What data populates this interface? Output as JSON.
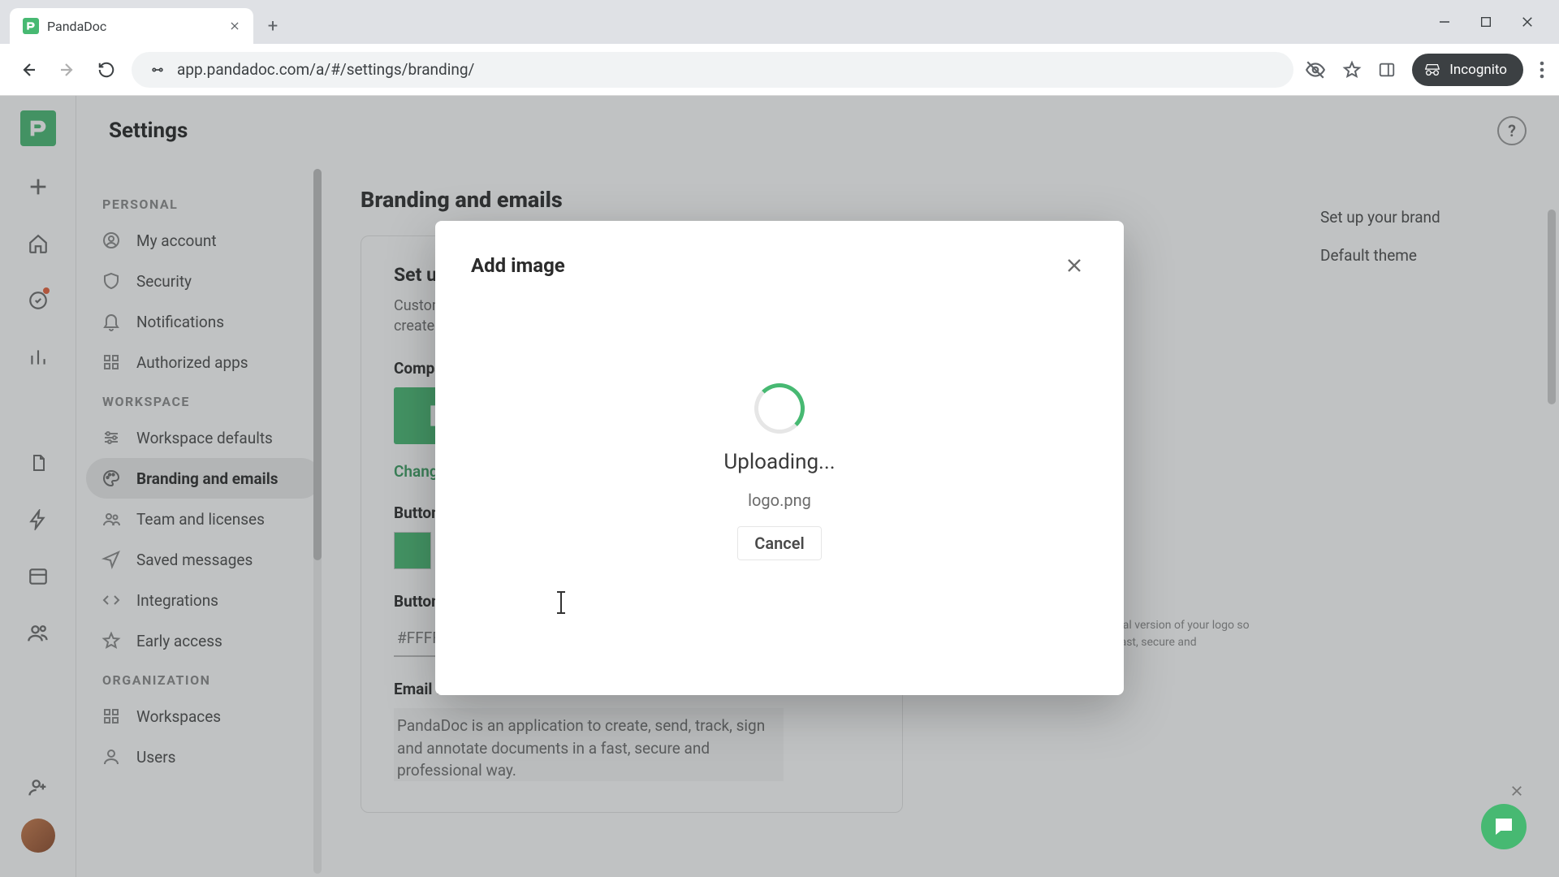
{
  "browser": {
    "tab_title": "PandaDoc",
    "url": "app.pandadoc.com/a/#/settings/branding/",
    "incognito_label": "Incognito"
  },
  "page": {
    "header_title": "Settings",
    "content_title": "Branding and emails"
  },
  "sidebar": {
    "sections": {
      "personal": "PERSONAL",
      "workspace": "WORKSPACE",
      "organization": "ORGANIZATION"
    },
    "items": {
      "my_account": "My account",
      "security": "Security",
      "notifications": "Notifications",
      "authorized_apps": "Authorized apps",
      "workspace_defaults": "Workspace defaults",
      "branding_emails": "Branding and emails",
      "team_licenses": "Team and licenses",
      "saved_messages": "Saved messages",
      "integrations": "Integrations",
      "early_access": "Early access",
      "workspaces": "Workspaces",
      "users": "Users"
    }
  },
  "branding": {
    "card_title": "Set up your brand",
    "card_desc": "Customize your branding — it will show up on documents you create and emails you send.",
    "company_logo_label": "Company logo",
    "change_link": "Change",
    "button_color_label": "Button color",
    "button_text_color_label": "Button text color",
    "button_text_color_value": "#FFFFFF",
    "email_footer_label": "Email footer text",
    "email_footer_value": "PandaDoc is an application to create, send, track, sign and annotate documents in a fast, secure and professional way.",
    "preview_note": "For best results, upload a horizontal version of your logo so it looks great on documents in a fast, secure and professional way."
  },
  "toc": {
    "brand": "Set up your brand",
    "theme": "Default theme"
  },
  "modal": {
    "title": "Add image",
    "status": "Uploading...",
    "filename": "logo.png",
    "cancel": "Cancel"
  },
  "colors": {
    "brand_green": "#47b972"
  }
}
